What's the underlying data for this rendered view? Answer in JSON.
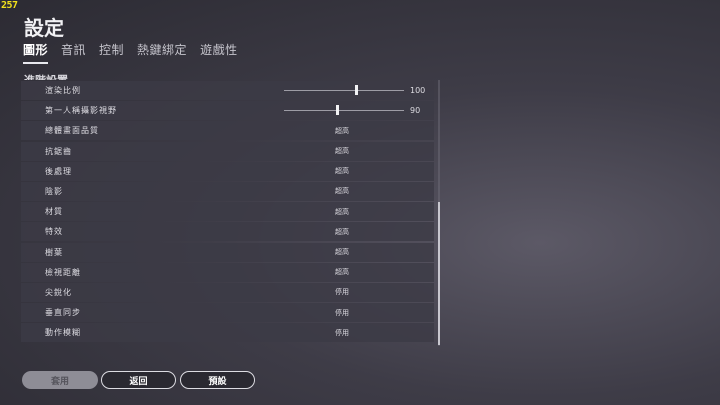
{
  "fps": "257",
  "title": "設定",
  "tabs": [
    {
      "label": "圖形",
      "active": true
    },
    {
      "label": "音訊",
      "active": false
    },
    {
      "label": "控制",
      "active": false
    },
    {
      "label": "熱鍵綁定",
      "active": false
    },
    {
      "label": "遊戲性",
      "active": false
    }
  ],
  "section_title": "進階設置",
  "settings": [
    {
      "label": "渲染比例",
      "type": "slider",
      "value": "100",
      "level": 0.59
    },
    {
      "label": "第一人稱攝影視野",
      "type": "slider",
      "value": "90",
      "level": 0.43
    },
    {
      "label": "總體畫面品質",
      "type": "option",
      "value": "超高"
    },
    {
      "label": "抗鋸齒",
      "type": "option",
      "value": "超高"
    },
    {
      "label": "後處理",
      "type": "option",
      "value": "超高"
    },
    {
      "label": "陰影",
      "type": "option",
      "value": "超高"
    },
    {
      "label": "材質",
      "type": "option",
      "value": "超高"
    },
    {
      "label": "特效",
      "type": "option",
      "value": "超高"
    },
    {
      "label": "樹葉",
      "type": "option",
      "value": "超高"
    },
    {
      "label": "檢視距離",
      "type": "option",
      "value": "超高"
    },
    {
      "label": "尖銳化",
      "type": "option",
      "value": "停用"
    },
    {
      "label": "垂直同步",
      "type": "option",
      "value": "停用"
    },
    {
      "label": "動作模糊",
      "type": "option",
      "value": "停用"
    }
  ],
  "buttons": {
    "apply": "套用",
    "back": "返回",
    "default": "預設"
  }
}
